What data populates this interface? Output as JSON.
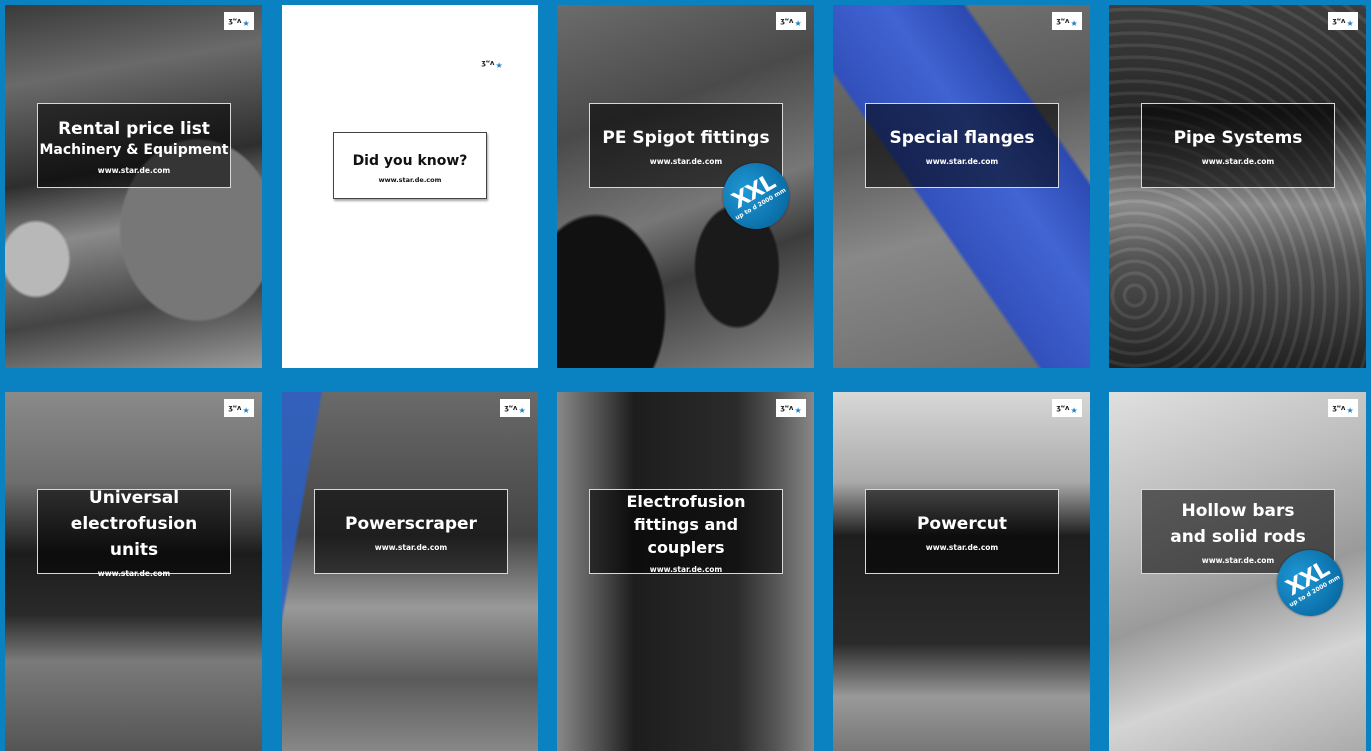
{
  "accent_color": "#0a82c1",
  "logo_text": "ʒʷʌ",
  "cards": [
    {
      "title": "Rental price list",
      "subtitle": "Machinery & Equipment",
      "url": "www.star.de.com"
    },
    {
      "title": "Did you know?",
      "url": "www.star.de.com"
    },
    {
      "title": "PE Spigot fittings",
      "url": "www.star.de.com",
      "badge": {
        "big": "XXL",
        "small": "up to d 2000 mm"
      }
    },
    {
      "title": "Special flanges",
      "url": "www.star.de.com"
    },
    {
      "title": "Pipe Systems",
      "url": "www.star.de.com"
    },
    {
      "title": "Universal electrofusion units",
      "url": "www.star.de.com"
    },
    {
      "title": "Powerscraper",
      "url": "www.star.de.com"
    },
    {
      "title": "Electrofusion fittings and couplers",
      "url": "www.star.de.com"
    },
    {
      "title": "Powercut",
      "url": "www.star.de.com"
    },
    {
      "title": "Hollow bars and solid rods",
      "url": "www.star.de.com",
      "badge": {
        "big": "XXL",
        "small": "up to d 2000 mm"
      }
    }
  ]
}
